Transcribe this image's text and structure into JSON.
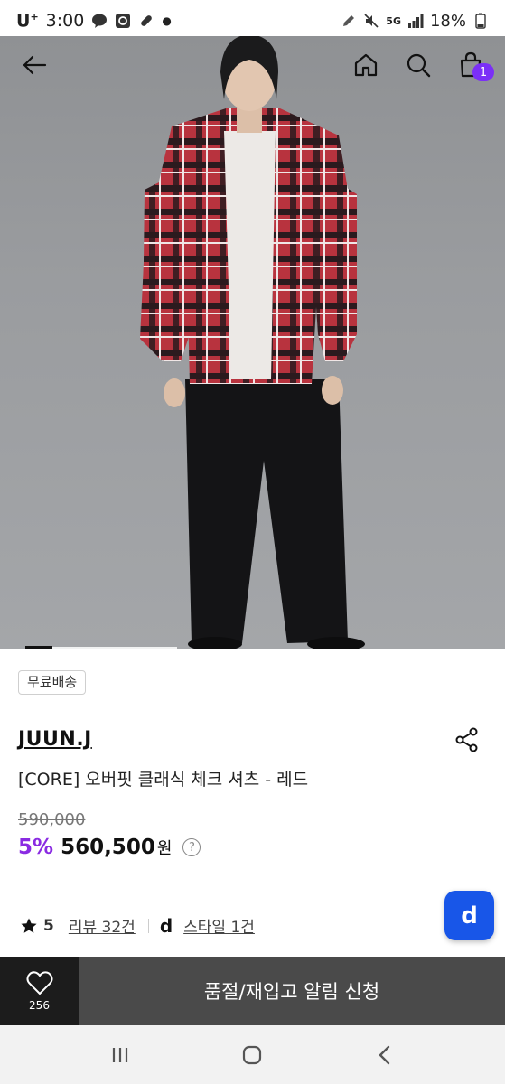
{
  "status_bar": {
    "carrier": "U",
    "carrier_sup": "+",
    "time": "3:00",
    "network": "5G",
    "battery": "18%"
  },
  "nav": {
    "back_icon": "arrow-left-icon",
    "home_icon": "home-icon",
    "search_icon": "search-icon",
    "cart_icon": "shopping-bag-icon",
    "cart_count": "1"
  },
  "gallery": {
    "progress": 0.18
  },
  "product": {
    "shipping_badge": "무료배송",
    "brand": "JUUN.J",
    "name": "[CORE] 오버핏 클래식 체크 셔츠 - 레드",
    "original_price": "590,000",
    "discount": "5%",
    "sale_price": "560,500",
    "currency": "원",
    "info_symbol": "?",
    "rating": "5",
    "review_link": "리뷰 32건",
    "style_logo": "d",
    "style_link": "스타일 1건"
  },
  "fab": {
    "label": "d"
  },
  "action_bar": {
    "like_count": "256",
    "restock_label": "품절/재입고 알림 신청"
  },
  "colors": {
    "accent": "#8a2be2",
    "badge": "#7b2ff7",
    "fab": "#1856e8"
  }
}
